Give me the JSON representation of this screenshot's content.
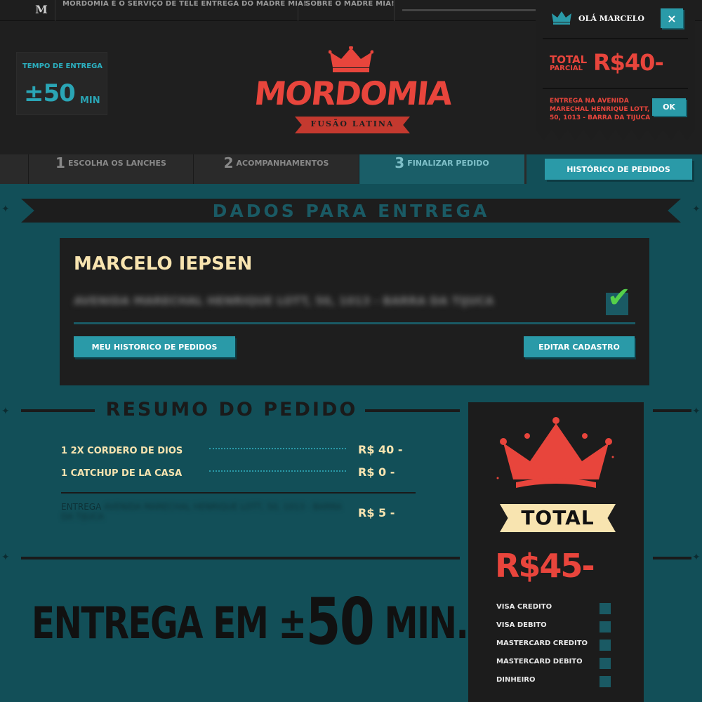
{
  "topbar": {
    "monogram": "M",
    "links": [
      "MORDOMIA É O SERVIÇO DE TELE ENTREGA DO MADRE MIA!",
      "SOBRE O MADRE MIA!"
    ]
  },
  "delivery_time": {
    "label": "TEMPO DE ENTREGA",
    "value": "±50",
    "unit": "MIN"
  },
  "brand": {
    "name": "MORDOMIA",
    "tagline": "FUSÃO LATINA"
  },
  "cart": {
    "greeting": "OLÁ MARCELO",
    "close_label": "×",
    "total_label": "TOTAL",
    "total_sublabel": "PARCIAL",
    "total_value": "R$40-",
    "address": "ENTREGA NA AVENIDA MARECHAL HENRIQUE LOTT, 50, 1013 - BARRA DA TIJUCA",
    "ok_label": "OK"
  },
  "steps": [
    {
      "num": "1",
      "label": "ESCOLHA OS LANCHES",
      "active": false
    },
    {
      "num": "2",
      "label": "ACOMPANHAMENTOS",
      "active": false
    },
    {
      "num": "3",
      "label": "FINALIZAR PEDIDO",
      "active": true
    }
  ],
  "history_button": "HISTÓRICO DE PEDIDOS",
  "delivery_section": {
    "title": "DADOS PARA ENTREGA",
    "customer_name": "MARCELO IEPSEN",
    "address": "AVENIDA MARECHAL HENRIQUE LOTT, 50, 1013 - BARRA DA TIJUCA",
    "my_history_button": "MEU HISTORICO DE PEDIDOS",
    "edit_button": "EDITAR CADASTRO"
  },
  "summary": {
    "title": "RESUMO DO PEDIDO",
    "items": [
      {
        "label": "1 2X CORDERO DE DIOS",
        "price": "R$ 40 -"
      },
      {
        "label": "1 CATCHUP DE LA CASA",
        "price": "R$ 0 -"
      }
    ],
    "delivery_label": "ENTREGA",
    "delivery_address": "AVENIDA MARECHAL HENRIQUE LOTT, 50, 1013 - BARRA DA TIJUCA",
    "delivery_price": "R$ 5 -",
    "eta_prefix": "ENTREGA EM ±",
    "eta_value": "50",
    "eta_suffix": "MIN."
  },
  "total_panel": {
    "label": "TOTAL",
    "value": "R$45-",
    "payment_methods": [
      "VISA CREDITO",
      "VISA DEBITO",
      "MASTERCARD CREDITO",
      "MASTERCARD DEBITO",
      "DINHEIRO"
    ]
  },
  "colors": {
    "accent": "#2a9aa8",
    "brand_red": "#e8453c",
    "cream": "#f8e4b0",
    "bg_teal": "#124f58",
    "dark": "#1e1e1e"
  },
  "icons": [
    "monogram-logo-icon",
    "crown-icon",
    "close-icon",
    "checkmark-icon",
    "star-ornament-icon"
  ]
}
